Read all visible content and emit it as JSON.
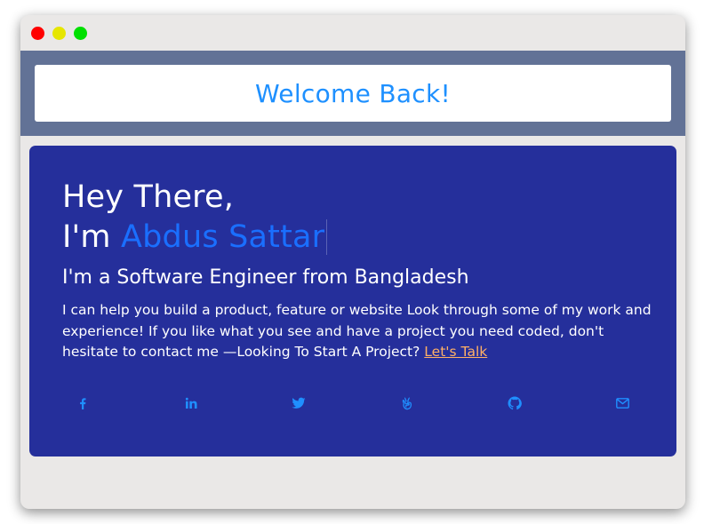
{
  "header": {
    "title": "Welcome Back!"
  },
  "hero": {
    "greeting_line1": "Hey There,",
    "greeting_prefix": "I'm ",
    "name": "Abdus Sattar",
    "subtitle": "I'm a Software Engineer from Bangladesh",
    "description": "I can help you build a product, feature or website Look through some of my work and experience! If you like what you see and have a project you need coded, don't hesitate to contact me —Looking To Start A Project? ",
    "cta_label": "Let's Talk"
  },
  "social_links": [
    {
      "icon": "facebook-icon"
    },
    {
      "icon": "linkedin-icon"
    },
    {
      "icon": "twitter-icon"
    },
    {
      "icon": "angellist-icon"
    },
    {
      "icon": "github-icon"
    },
    {
      "icon": "email-icon"
    }
  ],
  "colors": {
    "window_bg": "#eae8e7",
    "header_band": "#627296",
    "hero_bg": "#252f9b",
    "welcome_text": "#1e90ff",
    "name_accent": "#1a6fff",
    "cta": "#ffb066",
    "social_icon": "#1f8fff"
  }
}
